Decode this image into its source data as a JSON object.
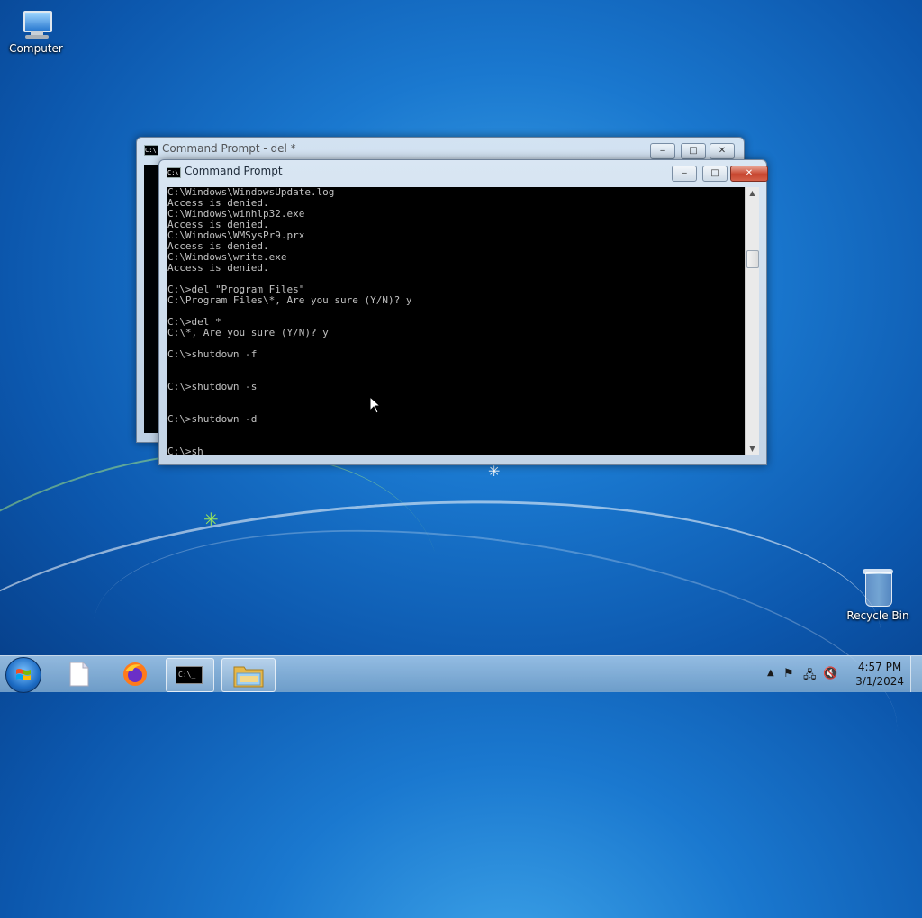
{
  "desktop": {
    "icons": [
      {
        "label": "Computer",
        "icon": "computer-icon"
      },
      {
        "label": "Recycle Bin",
        "icon": "recycle-bin-icon"
      }
    ]
  },
  "windows": {
    "back": {
      "title": "Command Prompt - del  *",
      "minimize": "‒",
      "maximize": "□",
      "close": "✕"
    },
    "front": {
      "title": "Command Prompt",
      "minimize": "‒",
      "maximize": "□",
      "close": "✕",
      "console_text": "C:\\Windows\\WindowsUpdate.log\nAccess is denied.\nC:\\Windows\\winhlp32.exe\nAccess is denied.\nC:\\Windows\\WMSysPr9.prx\nAccess is denied.\nC:\\Windows\\write.exe\nAccess is denied.\n\nC:\\>del \"Program Files\"\nC:\\Program Files\\*, Are you sure (Y/N)? y\n\nC:\\>del *\nC:\\*, Are you sure (Y/N)? y\n\nC:\\>shutdown -f\n\n\nC:\\>shutdown -s\n\n\nC:\\>shutdown -d\n\n\n",
      "prompt_line": "C:\\>sh"
    }
  },
  "taskbar": {
    "start": "start-button",
    "pinned": [
      {
        "name": "file-icon",
        "active": false
      },
      {
        "name": "firefox-icon",
        "active": false
      },
      {
        "name": "cmd-icon",
        "active": true
      },
      {
        "name": "explorer-icon",
        "active": true
      }
    ],
    "tray": {
      "time": "4:57 PM",
      "date": "3/1/2024",
      "icons": [
        "show-hidden-icons",
        "action-center-flag-icon",
        "network-icon",
        "volume-muted-icon"
      ]
    }
  },
  "colors": {
    "console_bg": "#000000",
    "console_fg": "#c0c0c0",
    "close_red": "#c7452e"
  }
}
